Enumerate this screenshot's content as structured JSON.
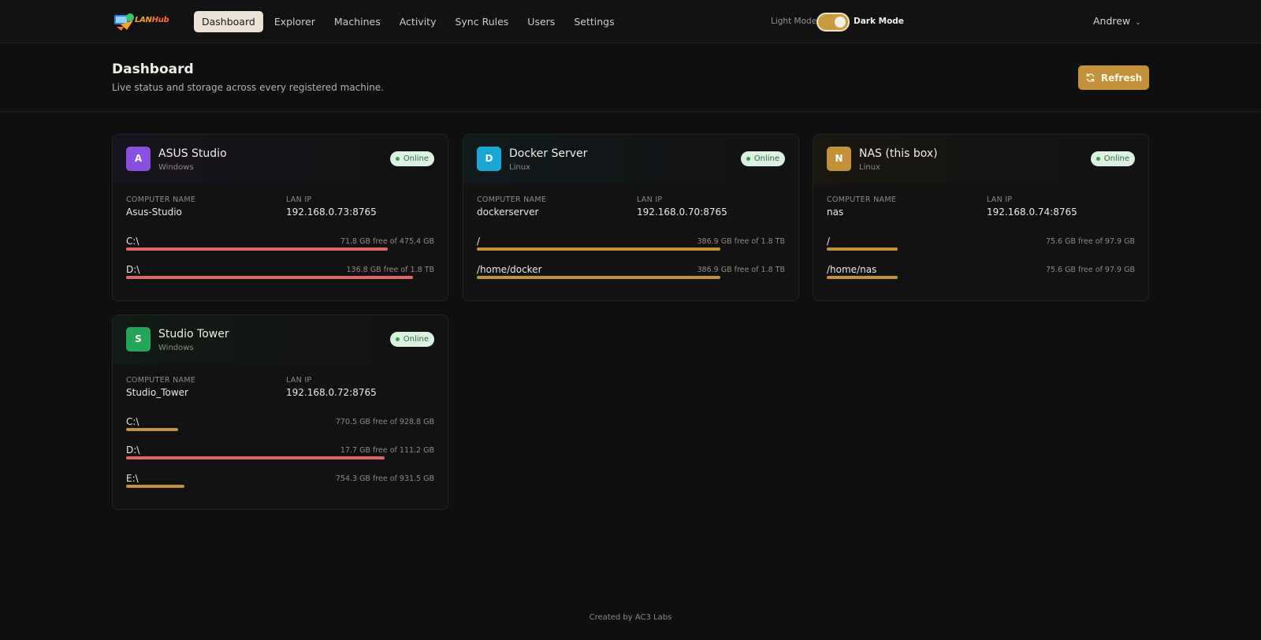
{
  "brand": {
    "name": "LANHub",
    "name_a": "LAN",
    "name_b": "Hub"
  },
  "nav": {
    "items": [
      {
        "label": "Dashboard",
        "active": true
      },
      {
        "label": "Explorer"
      },
      {
        "label": "Machines"
      },
      {
        "label": "Activity"
      },
      {
        "label": "Sync Rules"
      },
      {
        "label": "Users"
      },
      {
        "label": "Settings"
      }
    ]
  },
  "mode": {
    "light_label": "Light Mode",
    "dark_label": "Dark Mode",
    "dark_enabled": true
  },
  "user": {
    "name": "Andrew"
  },
  "header": {
    "title": "Dashboard",
    "subtitle": "Live status and storage across every registered machine.",
    "refresh_label": "Refresh"
  },
  "labels": {
    "computer_name": "COMPUTER NAME",
    "lan_ip": "LAN IP"
  },
  "colors": {
    "accent": "#c3913a",
    "bar_high": "#e06666",
    "bar_normal": "#c3913a",
    "online_bg": "#def0e2",
    "online_text": "#2c6e3a"
  },
  "machines": [
    {
      "initial": "A",
      "name": "ASUS Studio",
      "os": "Windows",
      "status": "Online",
      "avatar_color": "#8b4fe0",
      "head_tint": "#17131d",
      "computer_name": "Asus-Studio",
      "lan_ip": "192.168.0.73:8765",
      "drives": [
        {
          "name": "C:\\",
          "free_text": "71.8 GB free of 475.4 GB",
          "used_fraction": 0.85,
          "level": "high"
        },
        {
          "name": "D:\\",
          "free_text": "136.8 GB free of 1.8 TB",
          "used_fraction": 0.93,
          "level": "high"
        }
      ]
    },
    {
      "initial": "D",
      "name": "Docker Server",
      "os": "Linux",
      "status": "Online",
      "avatar_color": "#1aa7d6",
      "head_tint": "#101a1d",
      "computer_name": "dockerserver",
      "lan_ip": "192.168.0.70:8765",
      "drives": [
        {
          "name": "/",
          "free_text": "386.9 GB free of 1.8 TB",
          "used_fraction": 0.79,
          "level": "normal"
        },
        {
          "name": "/home/docker",
          "free_text": "386.9 GB free of 1.8 TB",
          "used_fraction": 0.79,
          "level": "normal"
        }
      ]
    },
    {
      "initial": "N",
      "name": "NAS (this box)",
      "os": "Linux",
      "status": "Online",
      "avatar_color": "#c3913a",
      "head_tint": "#1a1711",
      "computer_name": "nas",
      "lan_ip": "192.168.0.74:8765",
      "drives": [
        {
          "name": "/",
          "free_text": "75.6 GB free of 97.9 GB",
          "used_fraction": 0.23,
          "level": "normal"
        },
        {
          "name": "/home/nas",
          "free_text": "75.6 GB free of 97.9 GB",
          "used_fraction": 0.23,
          "level": "normal"
        }
      ]
    },
    {
      "initial": "S",
      "name": "Studio Tower",
      "os": "Windows",
      "status": "Online",
      "avatar_color": "#23a55a",
      "head_tint": "#111a14",
      "computer_name": "Studio_Tower",
      "lan_ip": "192.168.0.72:8765",
      "drives": [
        {
          "name": "C:\\",
          "free_text": "770.5 GB free of 928.8 GB",
          "used_fraction": 0.17,
          "level": "normal"
        },
        {
          "name": "D:\\",
          "free_text": "17.7 GB free of 111.2 GB",
          "used_fraction": 0.84,
          "level": "high"
        },
        {
          "name": "E:\\",
          "free_text": "754.3 GB free of 931.5 GB",
          "used_fraction": 0.19,
          "level": "normal"
        }
      ]
    }
  ],
  "footer": {
    "text": "Created by AC3 Labs"
  }
}
